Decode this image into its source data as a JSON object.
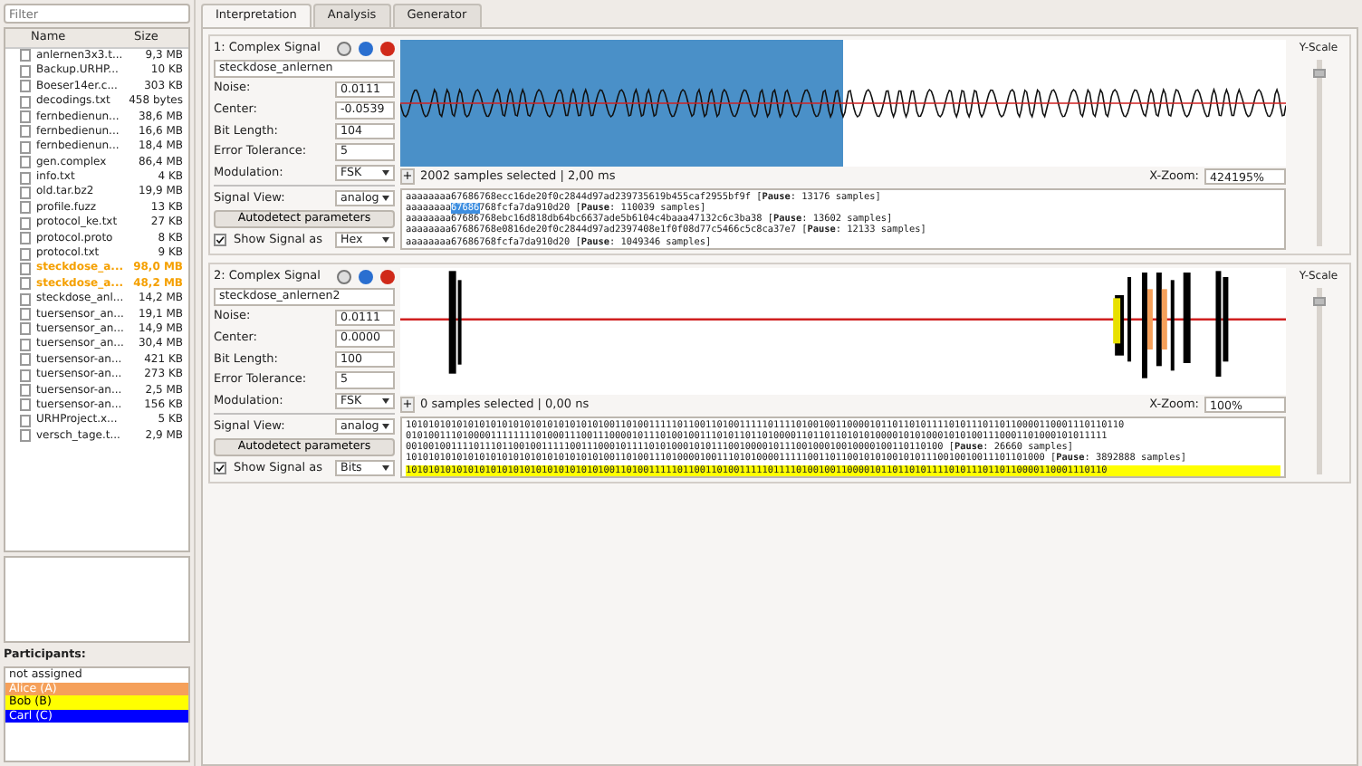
{
  "sidebar": {
    "filter": {
      "placeholder": "Filter"
    },
    "columns": [
      "Name",
      "Size"
    ],
    "files": [
      {
        "name": "anlernen3x3.t...",
        "size": "9,3 MB",
        "highlighted": false
      },
      {
        "name": "Backup.URHP...",
        "size": "10 KB",
        "highlighted": false
      },
      {
        "name": "Boeser14er.c...",
        "size": "303 KB",
        "highlighted": false
      },
      {
        "name": "decodings.txt",
        "size": "458 bytes",
        "highlighted": false
      },
      {
        "name": "fernbedienun...",
        "size": "38,6 MB",
        "highlighted": false
      },
      {
        "name": "fernbedienun...",
        "size": "16,6 MB",
        "highlighted": false
      },
      {
        "name": "fernbedienun...",
        "size": "18,4 MB",
        "highlighted": false
      },
      {
        "name": "gen.complex",
        "size": "86,4 MB",
        "highlighted": false
      },
      {
        "name": "info.txt",
        "size": "4 KB",
        "highlighted": false
      },
      {
        "name": "old.tar.bz2",
        "size": "19,9 MB",
        "highlighted": false
      },
      {
        "name": "profile.fuzz",
        "size": "13 KB",
        "highlighted": false
      },
      {
        "name": "protocol_ke.txt",
        "size": "27 KB",
        "highlighted": false
      },
      {
        "name": "protocol.proto",
        "size": "8 KB",
        "highlighted": false
      },
      {
        "name": "protocol.txt",
        "size": "9 KB",
        "highlighted": false
      },
      {
        "name": "steckdose_a...",
        "size": "98,0 MB",
        "highlighted": true
      },
      {
        "name": "steckdose_a...",
        "size": "48,2 MB",
        "highlighted": true
      },
      {
        "name": "steckdose_anl...",
        "size": "14,2 MB",
        "highlighted": false
      },
      {
        "name": "tuersensor_an...",
        "size": "19,1 MB",
        "highlighted": false
      },
      {
        "name": "tuersensor_an...",
        "size": "14,9 MB",
        "highlighted": false
      },
      {
        "name": "tuersensor_an...",
        "size": "30,4 MB",
        "highlighted": false
      },
      {
        "name": "tuersensor-an...",
        "size": "421 KB",
        "highlighted": false
      },
      {
        "name": "tuersensor-an...",
        "size": "273 KB",
        "highlighted": false
      },
      {
        "name": "tuersensor-an...",
        "size": "2,5 MB",
        "highlighted": false
      },
      {
        "name": "tuersensor-an...",
        "size": "156 KB",
        "highlighted": false
      },
      {
        "name": "URHProject.x...",
        "size": "5 KB",
        "highlighted": false
      },
      {
        "name": "versch_tage.t...",
        "size": "2,9 MB",
        "highlighted": false
      }
    ],
    "participants_label": "Participants:",
    "participants": [
      {
        "name": "not assigned"
      },
      {
        "name": "Alice (A)",
        "color": "#f5a05a"
      },
      {
        "name": "Bob (B)",
        "color": "#ffff00"
      },
      {
        "name": "Carl (C)",
        "color": "#0000ff"
      }
    ]
  },
  "tabs": [
    {
      "label": "Interpretation",
      "selected": true
    },
    {
      "label": "Analysis",
      "selected": false
    },
    {
      "label": "Generator",
      "selected": false
    }
  ],
  "signals": [
    {
      "title": "1: Complex Signal",
      "name": "steckdose_anlernen",
      "noise_label": "Noise:",
      "noise": "0.0111",
      "center_label": "Center:",
      "center": "-0.0539",
      "bit_length_label": "Bit Length:",
      "bit_length": "104",
      "tolerance_label": "Error Tolerance:",
      "tolerance": "5",
      "modulation_label": "Modulation:",
      "modulation": "FSK",
      "view_label": "Signal View:",
      "view": "analog",
      "autodetect": "Autodetect parameters",
      "show_label": "Show Signal as",
      "show_checked": true,
      "show_as": "Hex",
      "plus": "+",
      "selection_info": "2002  samples selected | 2,00 ms",
      "zoom_label": "X-Zoom:",
      "zoom": "424195%",
      "yscale_label": "Y-Scale",
      "yscale": {
        "level": 0.97
      },
      "kind": "wave",
      "lines": [
        {
          "highlighted": false,
          "parts": [
            {
              "text": "aaaaaaaa67686768ecc16de20f0c2844d97ad239735619b455caf2955bf9f [**Pause**: 13176 samples]",
              "selected": false
            }
          ]
        },
        {
          "highlighted": false,
          "parts": [
            {
              "text": "aaaaaaaa",
              "selected": false
            },
            {
              "text": "67686",
              "selected": true
            },
            {
              "text": "768fcfa7da910d20 [**Pause**: 110039 samples]",
              "selected": false
            }
          ]
        },
        {
          "highlighted": false,
          "parts": [
            {
              "text": "aaaaaaaa67686768ebc16d818db64bc6637ade5b6104c4baaa47132c6c3ba38 [**Pause**: 13602 samples]",
              "selected": false
            }
          ]
        },
        {
          "highlighted": false,
          "parts": [
            {
              "text": "aaaaaaaa67686768e0816de20f0c2844d97ad2397408e1f0f08d77c5466c5c8ca37e7 [**Pause**: 12133 samples]",
              "selected": false
            }
          ]
        },
        {
          "highlighted": false,
          "parts": [
            {
              "text": "aaaaaaaa67686768fcfa7da910d20 [**Pause**: 1049346 samples]",
              "selected": false
            }
          ]
        }
      ]
    },
    {
      "title": "2: Complex Signal",
      "name": "steckdose_anlernen2",
      "noise_label": "Noise:",
      "noise": "0.0111",
      "center_label": "Center:",
      "center": "0.0000",
      "bit_length_label": "Bit Length:",
      "bit_length": "100",
      "tolerance_label": "Error Tolerance:",
      "tolerance": "5",
      "modulation_label": "Modulation:",
      "modulation": "FSK",
      "view_label": "Signal View:",
      "view": "analog",
      "autodetect": "Autodetect parameters",
      "show_label": "Show Signal as",
      "show_checked": true,
      "show_as": "Bits",
      "plus": "+",
      "selection_info": "0  samples selected | 0,00 ns",
      "zoom_label": "X-Zoom:",
      "zoom": "100%",
      "yscale_label": "Y-Scale",
      "yscale": {
        "level": 0.97
      },
      "kind": "bursts",
      "lines": [
        {
          "highlighted": false,
          "parts": [
            {
              "text": "1010101010101010101010101010101010100110100111110110011010011111011110100100110000101101101011110101110110110000110001110110110",
              "selected": false
            }
          ]
        },
        {
          "highlighted": false,
          "parts": [
            {
              "text": "0101001110100001111111101000111001110000101110100100111010110110100001101101101010100001010100010101001110001101000101011111",
              "selected": false
            }
          ]
        },
        {
          "highlighted": false,
          "parts": [
            {
              "text": "00100100111101110110010011111001110001011110101000101011100100001011100100010010000100110110100 [**Pause**: 26660 samples]",
              "selected": false
            }
          ]
        },
        {
          "highlighted": false,
          "parts": [
            {
              "text": "10101010101010101010101010101010101001101001110100001001110101000011111001101100101010010101110010010011101101000 [**Pause**: 3892888 samples]",
              "selected": false
            }
          ]
        },
        {
          "highlighted": true,
          "parts": [
            {
              "text": "1010101010101010101010101010101010100110100111110110011010011111011110100100110000101101101011110101110110110000110001110110",
              "selected": false
            }
          ]
        }
      ]
    }
  ]
}
